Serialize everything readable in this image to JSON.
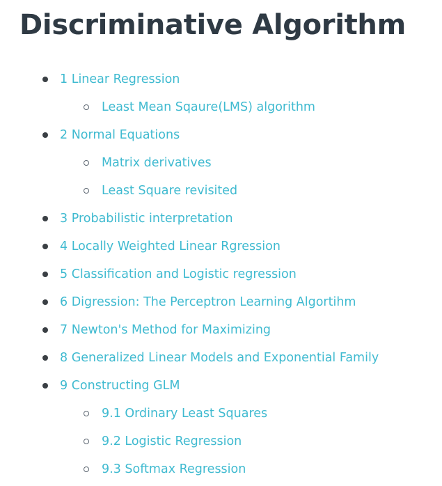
{
  "page": {
    "title": "Discriminative Algorithm"
  },
  "colors": {
    "title": "#2f3a44",
    "link": "#3fbad0",
    "bullet": "#3a3f44"
  },
  "toc": [
    {
      "level": 1,
      "text": "1 Linear Regression",
      "bullet": "disc"
    },
    {
      "level": 2,
      "text": "Least Mean Sqaure(LMS) algorithm",
      "bullet": "circle"
    },
    {
      "level": 1,
      "text": "2 Normal Equations",
      "bullet": "disc"
    },
    {
      "level": 2,
      "text": "Matrix derivatives",
      "bullet": "circle"
    },
    {
      "level": 2,
      "text": "Least Square revisited",
      "bullet": "circle"
    },
    {
      "level": 1,
      "text": "3 Probabilistic interpretation",
      "bullet": "disc"
    },
    {
      "level": 1,
      "text": "4 Locally Weighted Linear Rgression",
      "bullet": "disc"
    },
    {
      "level": 1,
      "text": "5 Classification and Logistic regression",
      "bullet": "disc"
    },
    {
      "level": 1,
      "text": "6 Digression: The Perceptron Learning Algortihm",
      "bullet": "disc"
    },
    {
      "level": 1,
      "text": "7 Newton's Method for Maximizing",
      "bullet": "disc"
    },
    {
      "level": 1,
      "text": "8 Generalized Linear Models and Exponential Family",
      "bullet": "disc"
    },
    {
      "level": 1,
      "text": "9 Constructing GLM",
      "bullet": "disc"
    },
    {
      "level": 2,
      "text": "9.1 Ordinary Least Squares",
      "bullet": "circle"
    },
    {
      "level": 2,
      "text": "9.2 Logistic Regression",
      "bullet": "circle"
    },
    {
      "level": 2,
      "text": "9.3 Softmax Regression",
      "bullet": "circle"
    }
  ]
}
